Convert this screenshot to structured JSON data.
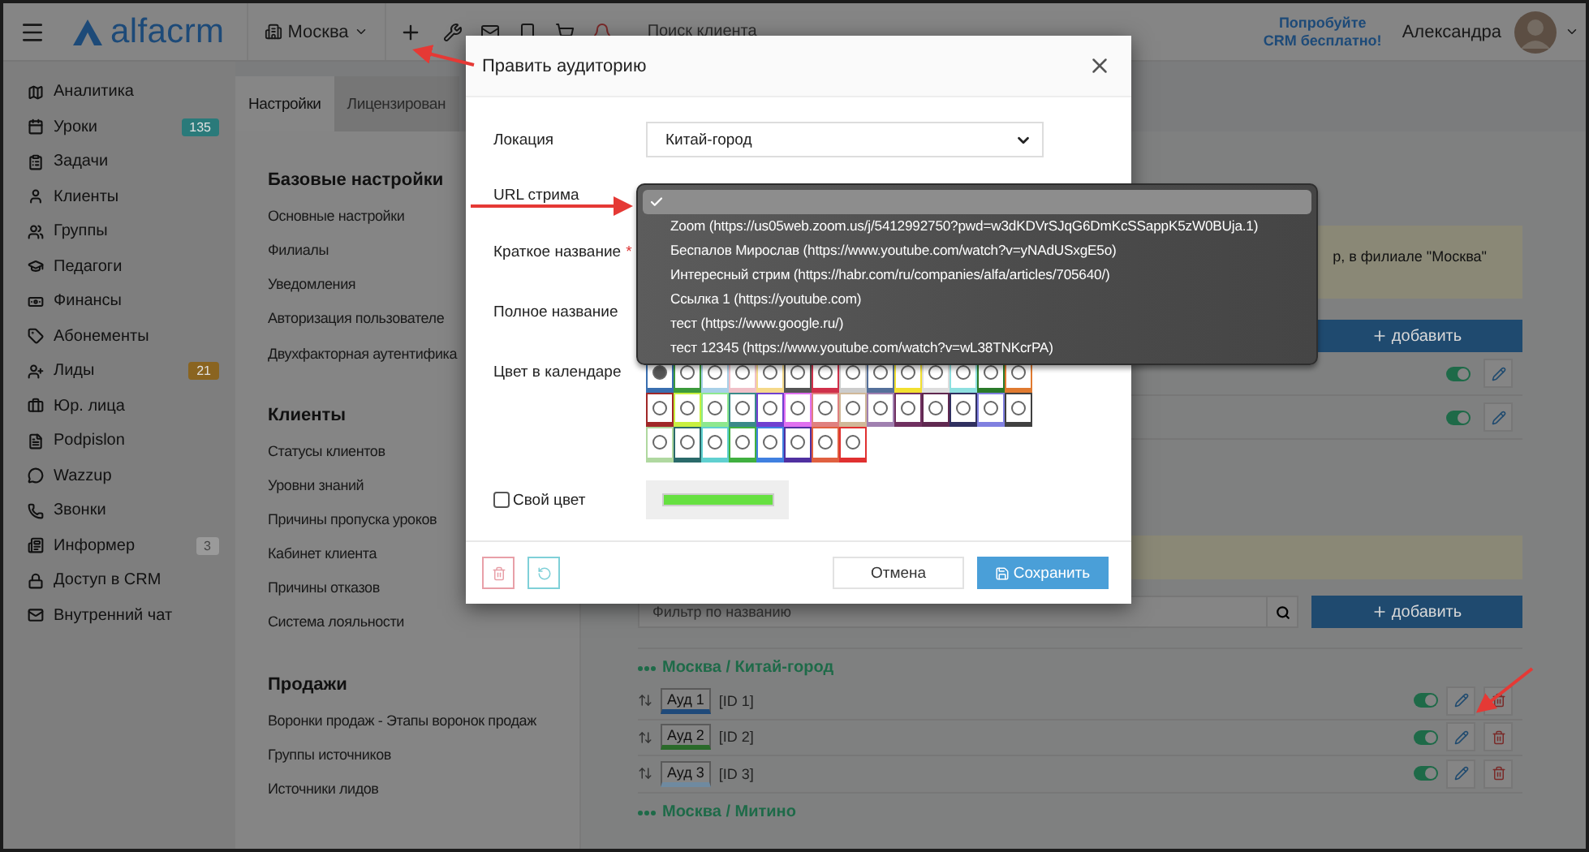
{
  "topbar": {
    "brand": "alfacrm",
    "branch": "Москва",
    "search_placeholder": "Поиск клиента",
    "promo": "Попробуйте CRM бесплатно!",
    "user": "Александра"
  },
  "sidebar": {
    "items": [
      {
        "label": "Аналитика"
      },
      {
        "label": "Уроки",
        "badge": {
          "text": "135",
          "color": "#2a7a7a"
        }
      },
      {
        "label": "Задачи"
      },
      {
        "label": "Клиенты"
      },
      {
        "label": "Группы"
      },
      {
        "label": "Педагоги"
      },
      {
        "label": "Финансы"
      },
      {
        "label": "Абонементы"
      },
      {
        "label": "Лиды",
        "badge": {
          "text": "21",
          "color": "#8a6420"
        }
      },
      {
        "label": "Юр. лица"
      },
      {
        "label": "Podpislon"
      },
      {
        "label": "Wazzup"
      },
      {
        "label": "Звонки"
      },
      {
        "label": "Информер",
        "badge": {
          "text": "3",
          "color": "#9a9a9a"
        }
      },
      {
        "label": "Доступ в CRM"
      },
      {
        "label": "Внутренний чат"
      }
    ]
  },
  "tabs": [
    {
      "label": "Настройки",
      "selected": true
    },
    {
      "label": "Лицензирован",
      "selected": false
    }
  ],
  "settings_sections": [
    {
      "title": "Базовые настройки",
      "links": [
        "Основные настройки",
        "Филиалы",
        "Уведомления",
        "Авторизация пользователе",
        "Двухфакторная аутентифика"
      ]
    },
    {
      "title": "Клиенты",
      "links": [
        "Статусы клиентов",
        "Уровни знаний",
        "Причины пропуска уроков",
        "Кабинет клиента",
        "Причины отказов",
        "Система лояльности"
      ]
    },
    {
      "title": "Продажи",
      "links": [
        "Воронки продаж - Этапы воронок продаж",
        "Группы источников",
        "Источники лидов"
      ]
    }
  ],
  "notice": "р, в филиале \"Москва\"",
  "add_button": "добавить",
  "setting_rows": [
    {
      "on": true
    },
    {
      "on": true
    }
  ],
  "filter": {
    "placeholder": "Фильтр по названию",
    "add_button": "добавить"
  },
  "room_groups": [
    {
      "title": "Москва / Китай-город",
      "rooms": [
        {
          "name": "Ауд 1",
          "id": "[ID 1]",
          "color": "#1f4a7a",
          "on": true
        },
        {
          "name": "Ауд 2",
          "id": "[ID 2]",
          "color": "#2a6a2a",
          "on": true
        },
        {
          "name": "Ауд 3",
          "id": "[ID 3]",
          "color": "#6f8aa0",
          "on": true
        }
      ]
    },
    {
      "title": "Москва / Митино"
    }
  ],
  "modal": {
    "title": "Править аудиторию",
    "fields": [
      {
        "kind": "select",
        "label": "Локация",
        "value": "Китай-город"
      },
      {
        "kind": "covered",
        "label": "URL стрима"
      },
      {
        "kind": "covered",
        "label": "Краткое название",
        "required_mark": "*"
      },
      {
        "kind": "covered",
        "label": "Полное название"
      }
    ],
    "calendar_label": "Цвет в календаре",
    "calendar_colors": [
      {
        "color": "#3a6fb0",
        "selected": true
      },
      {
        "color": "#3c9a3c",
        "selected": false
      },
      {
        "color": "#a8d0e8",
        "selected": false
      },
      {
        "color": "#f0c0c8",
        "selected": false
      },
      {
        "color": "#f5d98a",
        "selected": false
      },
      {
        "color": "#555555",
        "selected": false
      },
      {
        "color": "#d0304a",
        "selected": false
      },
      {
        "color": "#cccccc",
        "selected": false
      },
      {
        "color": "#55709a",
        "selected": false
      },
      {
        "color": "#f2e030",
        "selected": false
      },
      {
        "color": "#dddddd",
        "selected": false
      },
      {
        "color": "#8ee0e0",
        "selected": false
      },
      {
        "color": "#2a7a2a",
        "selected": false
      },
      {
        "color": "#e07a30",
        "selected": false
      },
      {
        "color": "#a02828",
        "selected": false
      },
      {
        "color": "#c8f040",
        "selected": false
      },
      {
        "color": "#8ee88e",
        "selected": false
      },
      {
        "color": "#3a8a8a",
        "selected": false
      },
      {
        "color": "#7040d0",
        "selected": false
      },
      {
        "color": "#e070f0",
        "selected": false
      },
      {
        "color": "#e08080",
        "selected": false
      },
      {
        "color": "#d0b898",
        "selected": false
      },
      {
        "color": "#a080b0",
        "selected": false
      },
      {
        "color": "#703060",
        "selected": false
      },
      {
        "color": "#602850",
        "selected": false
      },
      {
        "color": "#303060",
        "selected": false
      },
      {
        "color": "#8080e0",
        "selected": false
      },
      {
        "color": "#404040",
        "selected": false
      },
      {
        "color": "#b0d8a0",
        "selected": false
      },
      {
        "color": "#2a6a6a",
        "selected": false
      },
      {
        "color": "#60d0d0",
        "selected": false
      },
      {
        "color": "#40b040",
        "selected": false
      },
      {
        "color": "#4080e0",
        "selected": false
      },
      {
        "color": "#5030a0",
        "selected": false
      },
      {
        "color": "#e06040",
        "selected": false
      },
      {
        "color": "#e03030",
        "selected": false
      }
    ],
    "custom_color": {
      "label": "Свой цвет",
      "checked": false,
      "color": "#66e040"
    },
    "cancel": "Отмена",
    "save": "Сохранить"
  },
  "url_dropdown": {
    "options": [
      {
        "selected": true
      },
      {
        "label": "Zoom (https://us05web.zoom.us/j/5412992750?pwd=w3dKDVrSJqG6DmKcSSappK5zW0BUja.1)",
        "selected": false
      },
      {
        "label": "Беспалов Мирослав (https://www.youtube.com/watch?v=yNAdUSxgE5o)",
        "selected": false
      },
      {
        "label": "Интересный стрим (https://habr.com/ru/companies/alfa/articles/705640/)",
        "selected": false
      },
      {
        "label": "Ссылка 1 (https://youtube.com)",
        "selected": false
      },
      {
        "label": "тест (https://www.google.ru/)",
        "selected": false
      },
      {
        "label": "тест 12345 (https://www.youtube.com/watch?v=wL38TNKcrPA)",
        "selected": false
      }
    ]
  }
}
